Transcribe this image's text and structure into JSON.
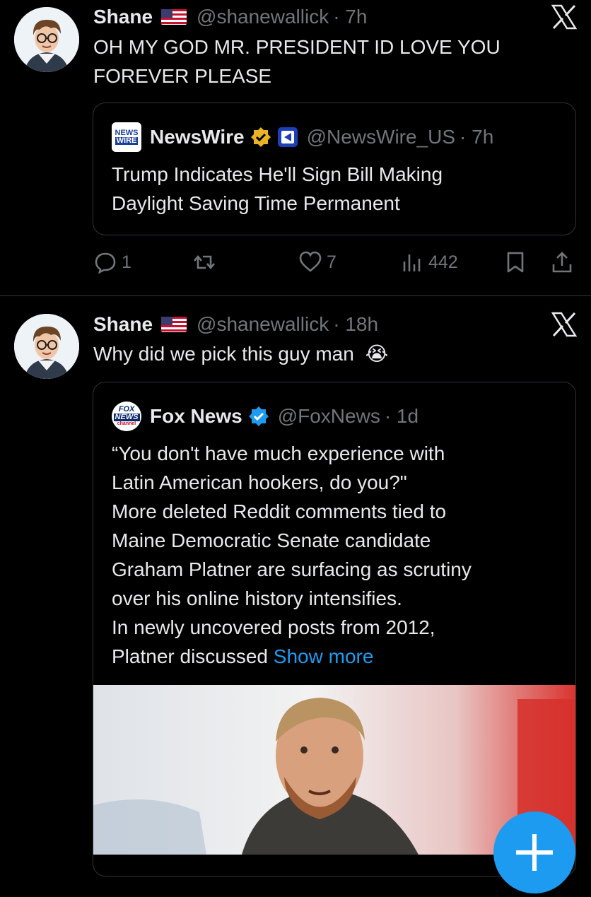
{
  "tweets": [
    {
      "name": "Shane",
      "handle": "@shanewallick",
      "time": "· 7h",
      "text_lines": [
        "OH MY GOD MR. PRESIDENT ID LOVE YOU",
        "FOREVER PLEASE"
      ],
      "quote": {
        "logo_text": [
          "NEWS",
          "WIRE"
        ],
        "name": "NewsWire",
        "handle": "@NewsWire_US",
        "time": "· 7h",
        "text_lines": [
          "Trump Indicates He'll Sign Bill Making",
          "Daylight Saving Time Permanent"
        ]
      },
      "actions": {
        "replies": "1",
        "retweets": "",
        "likes": "7",
        "views": "442"
      }
    },
    {
      "name": "Shane",
      "handle": "@shanewallick",
      "time": "· 18h",
      "text": "Why did we pick this guy man",
      "emoji": "😭",
      "quote": {
        "logo_text": [
          "FOX",
          "NEWS",
          "channel"
        ],
        "name": "Fox News",
        "handle": "@FoxNews",
        "time": "· 1d",
        "text_lines": [
          "“You don't have much experience with",
          "Latin American hookers, do you?\"",
          "More deleted Reddit comments tied to",
          "Maine Democratic Senate candidate",
          "Graham Platner are surfacing as scrutiny",
          "over his online history intensifies.",
          "In newly uncovered posts from 2012,"
        ],
        "last_line": "Platner discussed ",
        "show_more": "Show more"
      }
    }
  ],
  "icons": {
    "close": "x-logo-icon",
    "reply": "reply-icon",
    "retweet": "retweet-icon",
    "like": "heart-icon",
    "views": "views-icon",
    "bookmark": "bookmark-icon",
    "share": "share-icon"
  },
  "colors": {
    "background": "#000000",
    "text": "#e7e9ea",
    "muted": "#71767b",
    "accent": "#1d9bf0",
    "border": "#2f3336",
    "verified_gold": "#e8b324",
    "verified_blue": "#1d9bf0"
  }
}
